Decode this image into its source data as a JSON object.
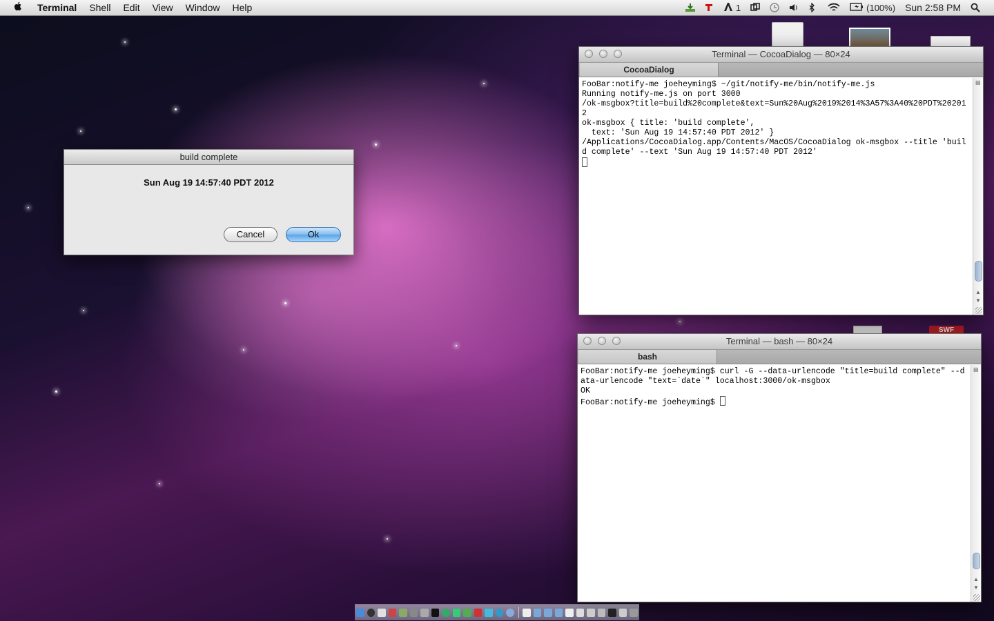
{
  "menubar": {
    "app_name": "Terminal",
    "items": [
      "Shell",
      "Edit",
      "View",
      "Window",
      "Help"
    ],
    "status": {
      "notification_count": "1",
      "battery": "(100%)",
      "clock": "Sun 2:58 PM"
    }
  },
  "dialog": {
    "title": "build complete",
    "message": "Sun Aug 19 14:57:40 PDT 2012",
    "cancel_label": "Cancel",
    "ok_label": "Ok"
  },
  "terminal_top": {
    "title": "Terminal — CocoaDialog — 80×24",
    "tab": "CocoaDialog",
    "lines": [
      "FooBar:notify-me joeheyming$ ~/git/notify-me/bin/notify-me.js",
      "Running notify-me.js on port 3000",
      "/ok-msgbox?title=build%20complete&text=Sun%20Aug%2019%2014%3A57%3A40%20PDT%20201",
      "2",
      "ok-msgbox { title: 'build complete',",
      "  text: 'Sun Aug 19 14:57:40 PDT 2012' }",
      "/Applications/CocoaDialog.app/Contents/MacOS/CocoaDialog ok-msgbox --title 'buil",
      "d complete' --text 'Sun Aug 19 14:57:40 PDT 2012'"
    ]
  },
  "terminal_bottom": {
    "title": "Terminal — bash — 80×24",
    "tab": "bash",
    "lines": [
      "FooBar:notify-me joeheyming$ curl -G --data-urlencode \"title=build complete\" --d",
      "ata-urlencode \"text=`date`\" localhost:3000/ok-msgbox",
      "OK"
    ],
    "prompt": "FooBar:notify-me joeheyming$ "
  },
  "desktop": {
    "icon_label": "SWF"
  }
}
